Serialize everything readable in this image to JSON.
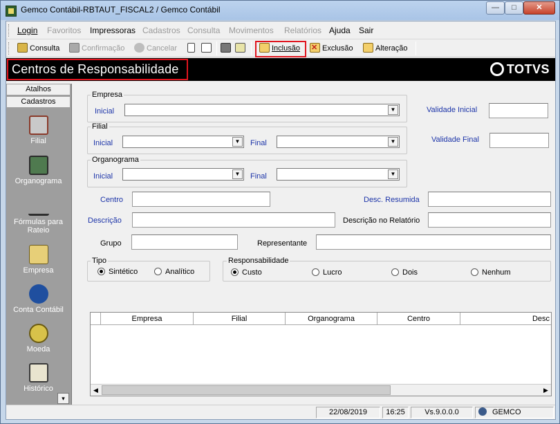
{
  "window": {
    "title": "Gemco Contábil-RBTAUT_FISCAL2 / Gemco Contábil",
    "minimize": "—",
    "maximize": "□",
    "close": "✕"
  },
  "menu": {
    "items": [
      {
        "label": "Login",
        "enabled": true
      },
      {
        "label": "Favoritos",
        "enabled": false
      },
      {
        "label": "Impressoras",
        "enabled": true
      },
      {
        "label": "Cadastros",
        "enabled": false
      },
      {
        "label": "Consulta",
        "enabled": false
      },
      {
        "label": "Movimentos",
        "enabled": false
      },
      {
        "label": "Relatórios",
        "enabled": false
      },
      {
        "label": "Ajuda",
        "enabled": true
      },
      {
        "label": "Sair",
        "enabled": true
      }
    ]
  },
  "toolbar": {
    "consulta": "Consulta",
    "confirmacao": "Confirmação",
    "cancelar": "Cancelar",
    "inclusao": "Inclusão",
    "exclusao": "Exclusão",
    "alteracao": "Alteração"
  },
  "header": {
    "title": "Centros de Responsabilidade",
    "logo": "TOTVS"
  },
  "sidebar": {
    "tabs": [
      "Atalhos",
      "Cadastros"
    ],
    "items": [
      {
        "label": "Filial",
        "icon": "building-icon",
        "color": "#c9c9c9"
      },
      {
        "label": "Organograma",
        "icon": "org-chart-icon",
        "color": "#4f7a4f"
      },
      {
        "label": "Fórmulas para Rateio",
        "icon": "formula-icon",
        "color": "#2e2e2e"
      },
      {
        "label": "Empresa",
        "icon": "factory-icon",
        "color": "#e7cf78"
      },
      {
        "label": "Conta Contábil",
        "icon": "money-icon",
        "color": "#1f4f9f"
      },
      {
        "label": "Moeda",
        "icon": "coins-icon",
        "color": "#d8c24a"
      },
      {
        "label": "Histórico",
        "icon": "notebook-icon",
        "color": "#e9e4cf"
      }
    ],
    "scroll_down": "▾"
  },
  "form": {
    "empresa": {
      "group": "Empresa",
      "inicial": "Inicial",
      "value": ""
    },
    "filial": {
      "group": "Filial",
      "inicial": "Inicial",
      "final": "Final",
      "value_inicial": "",
      "value_final": ""
    },
    "organograma": {
      "group": "Organograma",
      "inicial": "Inicial",
      "final": "Final",
      "value_inicial": "",
      "value_final": ""
    },
    "validade_inicial": {
      "label": "Validade Inicial",
      "value": ""
    },
    "validade_final": {
      "label": "Validade Final",
      "value": ""
    },
    "centro": {
      "label": "Centro",
      "value": ""
    },
    "desc_resumida": {
      "label": "Desc. Resumida",
      "value": ""
    },
    "descricao": {
      "label": "Descrição",
      "value": ""
    },
    "descricao_relatorio": {
      "label": "Descrição no Relatório",
      "value": ""
    },
    "grupo": {
      "label": "Grupo",
      "value": ""
    },
    "representante": {
      "label": "Representante",
      "value": ""
    },
    "tipo": {
      "group": "Tipo",
      "options": [
        "Sintético",
        "Analítico"
      ],
      "selected": "Sintético"
    },
    "responsabilidade": {
      "group": "Responsabilidade",
      "options": [
        "Custo",
        "Lucro",
        "Dois",
        "Nenhum"
      ],
      "selected": "Custo"
    }
  },
  "grid": {
    "columns": [
      "Empresa",
      "Filial",
      "Organograma",
      "Centro",
      "Desc"
    ],
    "rows": []
  },
  "status": {
    "date": "22/08/2019",
    "time": "16:25",
    "version": "Vs.9.0.0.0",
    "user": "GEMCO"
  },
  "colors": {
    "highlight": "#e0141e",
    "header_bg": "#000000",
    "label_blue": "#1b33a8",
    "sidebar_bg": "#9e9e9e"
  }
}
